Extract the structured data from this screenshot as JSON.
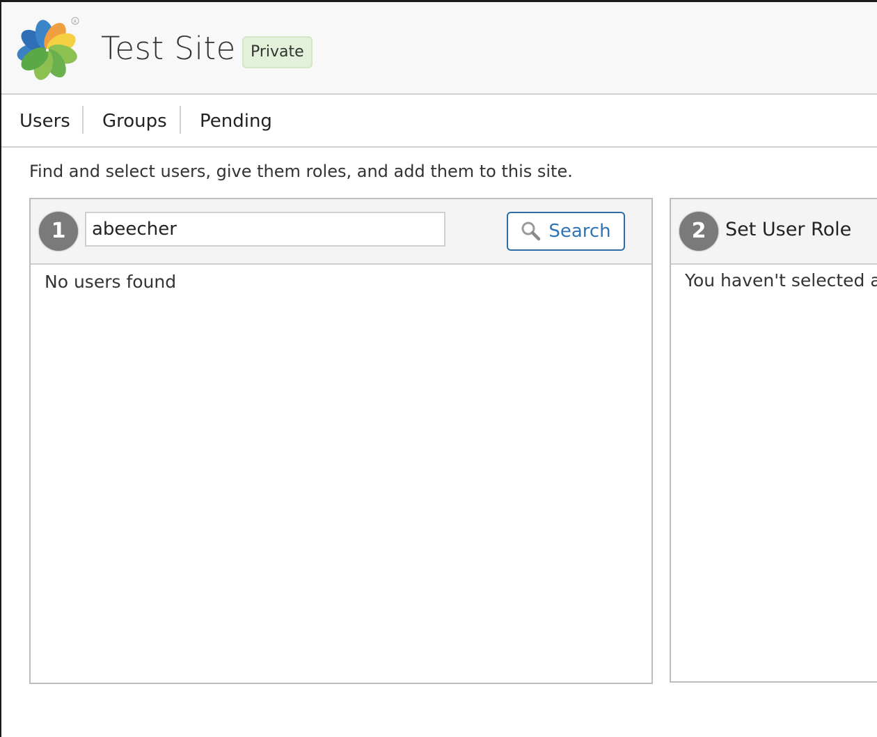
{
  "header": {
    "logo": "alfresco-flower-logo",
    "site_title": "Test Site",
    "visibility_badge": "Private"
  },
  "tabs": [
    {
      "label": "Users",
      "active": true
    },
    {
      "label": "Groups",
      "active": false
    },
    {
      "label": "Pending",
      "active": false
    }
  ],
  "intro_text": "Find and select users, give them roles, and add them to this site.",
  "find_panel": {
    "step_number": "1",
    "search_value": "abeecher",
    "search_placeholder": "",
    "search_button_label": "Search",
    "search_icon": "magnifier-icon",
    "result_message": "No users found"
  },
  "role_panel": {
    "step_number": "2",
    "title": "Set User Role",
    "message": "You haven't selected any users yet."
  },
  "colors": {
    "accent_blue": "#2f74b5",
    "badge_bg": "#e3f0da",
    "step_circle": "#7a7a7a"
  }
}
